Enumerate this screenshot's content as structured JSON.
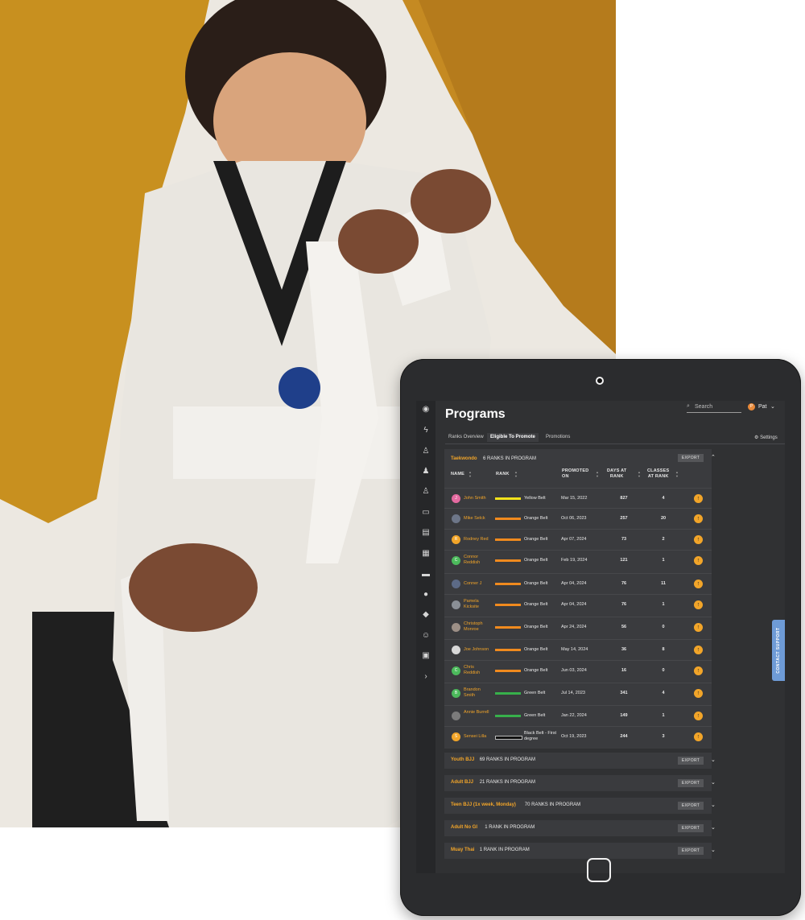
{
  "header": {
    "title": "Programs",
    "search_placeholder": "Search",
    "user_name": "Pat",
    "user_initial": "P"
  },
  "tabs": [
    {
      "label": "Ranks Overview",
      "active": false
    },
    {
      "label": "Eligible To Promote",
      "active": true
    },
    {
      "label": "Promotions",
      "active": false
    }
  ],
  "settings_label": "Settings",
  "export_label": "EXPORT",
  "contact_support": "CONTACT SUPPORT",
  "sidebar_icons": [
    "dashboard-icon",
    "lightning-icon",
    "add-user-icon",
    "group-icon",
    "check-user-icon",
    "id-card-icon",
    "clipboard-icon",
    "calendar-icon",
    "folder-icon",
    "chat-icon",
    "tag-icon",
    "smile-icon",
    "wallet-icon",
    "chevron-right-icon"
  ],
  "program": {
    "name": "Taekwondo",
    "count": "6 RANKS IN PROGRAM",
    "columns": {
      "name": "NAME",
      "rank": "RANK",
      "promoted_1": "PROMOTED",
      "promoted_2": "ON",
      "days_1": "DAYS AT",
      "days_2": "RANK",
      "classes_1": "CLASSES",
      "classes_2": "AT RANK"
    },
    "rows": [
      {
        "initial": "J",
        "avatar": "#e46aa0",
        "name": "John Smith",
        "belt": "Yellow Belt",
        "belt_color": "#f3e21b",
        "promoted": "Mar 15, 2022",
        "days": "827",
        "classes": "4"
      },
      {
        "initial": "",
        "avatar": "#6d7688",
        "name": "Mike Selck",
        "belt": "Orange Belt",
        "belt_color": "#f08a1e",
        "promoted": "Oct 06, 2023",
        "days": "257",
        "classes": "20"
      },
      {
        "initial": "R",
        "avatar": "#f2a529",
        "name": "Rodney Red",
        "belt": "Orange Belt",
        "belt_color": "#f08a1e",
        "promoted": "Apr 07, 2024",
        "days": "73",
        "classes": "2"
      },
      {
        "initial": "C",
        "avatar": "#4cba5c",
        "name": "Connor Reddish",
        "belt": "Orange Belt",
        "belt_color": "#f08a1e",
        "promoted": "Feb 19, 2024",
        "days": "121",
        "classes": "1"
      },
      {
        "initial": "",
        "avatar": "#5c6a86",
        "name": "Conner J",
        "belt": "Orange Belt",
        "belt_color": "#f08a1e",
        "promoted": "Apr 04, 2024",
        "days": "76",
        "classes": "11"
      },
      {
        "initial": "",
        "avatar": "#8a8f96",
        "name": "Pamela Kicksite",
        "belt": "Orange Belt",
        "belt_color": "#f08a1e",
        "promoted": "Apr 04, 2024",
        "days": "76",
        "classes": "1"
      },
      {
        "initial": "",
        "avatar": "#9c8f86",
        "name": "Christoph Monroe",
        "belt": "Orange Belt",
        "belt_color": "#f08a1e",
        "promoted": "Apr 24, 2024",
        "days": "56",
        "classes": "0"
      },
      {
        "initial": "",
        "avatar": "#d8d8d8",
        "name": "Joe Johnson",
        "belt": "Orange Belt",
        "belt_color": "#f08a1e",
        "promoted": "May 14, 2024",
        "days": "36",
        "classes": "8"
      },
      {
        "initial": "C",
        "avatar": "#4cba5c",
        "name": "Chris Reddish",
        "belt": "Orange Belt",
        "belt_color": "#f08a1e",
        "promoted": "Jun 03, 2024",
        "days": "16",
        "classes": "0"
      },
      {
        "initial": "B",
        "avatar": "#4cba5c",
        "name": "Brandon Smith",
        "belt": "Green Belt",
        "belt_color": "#37b04b",
        "promoted": "Jul 14, 2023",
        "days": "341",
        "classes": "4"
      },
      {
        "initial": "",
        "avatar": "#7b7b7b",
        "name": "Annie Burrell",
        "belt": "Green Belt",
        "belt_color": "#37b04b",
        "promoted": "Jan 22, 2024",
        "days": "149",
        "classes": "1"
      },
      {
        "initial": "S",
        "avatar": "#f2a529",
        "name": "Sensei Lilla",
        "belt": "Black Belt - First degree",
        "belt_color": "#111111",
        "promoted": "Oct 19, 2023",
        "days": "244",
        "classes": "3"
      }
    ]
  },
  "other_programs": [
    {
      "name": "Youth BJJ",
      "count": "69 RANKS IN PROGRAM"
    },
    {
      "name": "Adult BJJ",
      "count": "21 RANKS IN PROGRAM"
    },
    {
      "name": "Teen BJJ (1x week, Monday)",
      "count": "70 RANKS IN PROGRAM"
    },
    {
      "name": "Adult No GI",
      "count": "1 RANK IN PROGRAM"
    },
    {
      "name": "Muay Thai",
      "count": "1 RANK IN PROGRAM"
    }
  ]
}
